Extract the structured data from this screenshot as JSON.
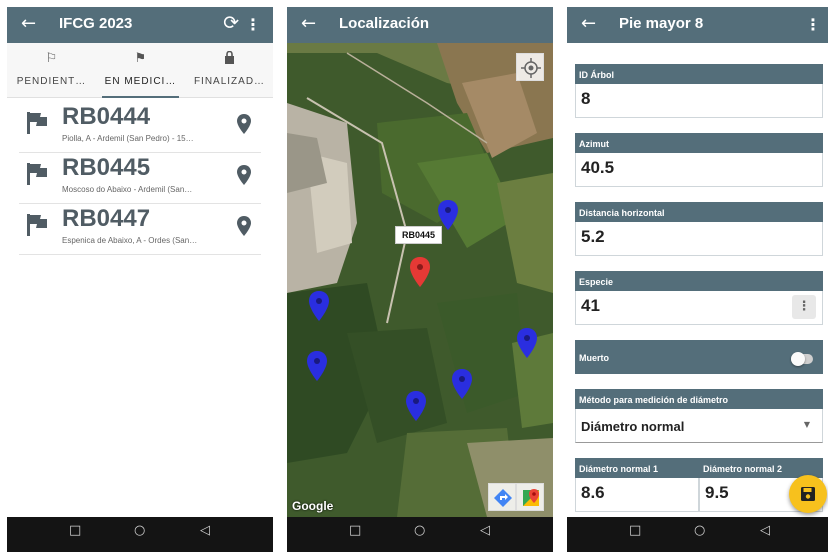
{
  "screen1": {
    "title": "IFCG 2023",
    "tabs": [
      {
        "label": "PENDIENT…",
        "icon": "flag-outline-icon"
      },
      {
        "label": "EN MEDICI…",
        "icon": "flag-icon"
      },
      {
        "label": "FINALIZAD…",
        "icon": "lock-icon"
      }
    ],
    "sites": [
      {
        "code": "RB0444",
        "place": "Piolla, A - Ardemil (San Pedro) - 15…"
      },
      {
        "code": "RB0445",
        "place": "Moscoso do Abaixo - Ardemil (San…"
      },
      {
        "code": "RB0447",
        "place": "Espenica de Abaixo, A - Ordes (San…"
      }
    ]
  },
  "screen2": {
    "title": "Localización",
    "selected_marker_label": "RB0445",
    "attribution": "Google"
  },
  "screen3": {
    "title": "Pie mayor 8",
    "fields": {
      "tree_id": {
        "label": "ID Árbol",
        "value": "8"
      },
      "azimuth": {
        "label": "Azimut",
        "value": "40.5"
      },
      "distance": {
        "label": "Distancia horizontal",
        "value": "5.2"
      },
      "species": {
        "label": "Especie",
        "value": "41"
      },
      "dead": {
        "label": "Muerto",
        "value": false
      },
      "method": {
        "label": "Método para medición de diámetro",
        "value": "Diámetro normal"
      },
      "diam1": {
        "label": "Diámetro normal 1",
        "value": "8.6"
      },
      "diam2": {
        "label": "Diámetro normal 2",
        "value": "9.5"
      }
    }
  },
  "colors": {
    "appbar": "#546e7a",
    "fab": "#f7c11d",
    "marker_blue": "#2a2ee0",
    "marker_red": "#e53935"
  }
}
